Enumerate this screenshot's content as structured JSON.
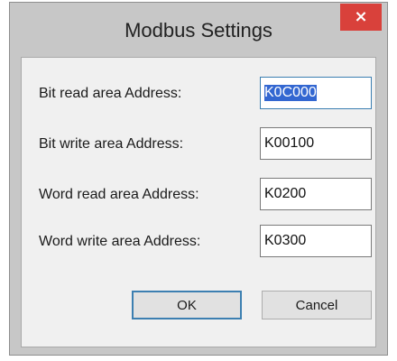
{
  "window": {
    "title": "Modbus Settings",
    "close_label": "×"
  },
  "fields": [
    {
      "label": "Bit read area Address:",
      "value": "K0C000",
      "selected": true
    },
    {
      "label": "Bit write area Address:",
      "value": "K00100",
      "selected": false
    },
    {
      "label": "Word read area Address:",
      "value": "K0200",
      "selected": false
    },
    {
      "label": "Word write area Address:",
      "value": "K0300",
      "selected": false
    }
  ],
  "buttons": {
    "ok_label": "OK",
    "cancel_label": "Cancel"
  },
  "colors": {
    "close_button": "#d9413b",
    "focus_border": "#3c7fb1",
    "window_frame": "#c7c7c7",
    "client_area": "#f0f0f0"
  },
  "icons": {
    "close": "close-icon"
  }
}
